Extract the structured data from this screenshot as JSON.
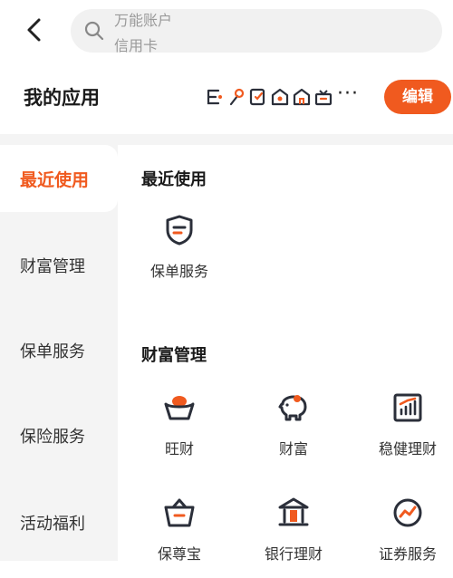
{
  "header": {
    "back_icon": "chevron-left-icon",
    "search": {
      "icon": "search-icon",
      "placeholder_line1": "万能账户",
      "placeholder_line2": "信用卡"
    }
  },
  "app_header": {
    "title": "我的应用",
    "more": "···",
    "edit_label": "编辑",
    "shortcut_icons": [
      "wealth-icon",
      "pin-icon",
      "doc-icon",
      "shield-icon",
      "home-icon",
      "gift-icon"
    ]
  },
  "sidebar": {
    "items": [
      {
        "label": "最近使用",
        "active": true
      },
      {
        "label": "财富管理",
        "active": false
      },
      {
        "label": "保单服务",
        "active": false
      },
      {
        "label": "保险服务",
        "active": false
      },
      {
        "label": "活动福利",
        "active": false
      }
    ]
  },
  "sections": [
    {
      "title": "最近使用",
      "items": [
        {
          "label": "保单服务",
          "icon": "policy-shield-icon"
        }
      ]
    },
    {
      "title": "财富管理",
      "items": [
        {
          "label": "旺财",
          "icon": "gold-ingot-icon"
        },
        {
          "label": "财富",
          "icon": "piggy-bank-icon"
        },
        {
          "label": "稳健理财",
          "icon": "growth-chart-icon"
        },
        {
          "label": "保尊宝",
          "icon": "basket-icon"
        },
        {
          "label": "银行理财",
          "icon": "bank-icon"
        },
        {
          "label": "证券服务",
          "icon": "trend-circle-icon"
        }
      ]
    }
  ],
  "colors": {
    "accent": "#f05a1f",
    "sidebar_bg": "#f4f4f4",
    "icon_dark": "#2b2f3a"
  }
}
